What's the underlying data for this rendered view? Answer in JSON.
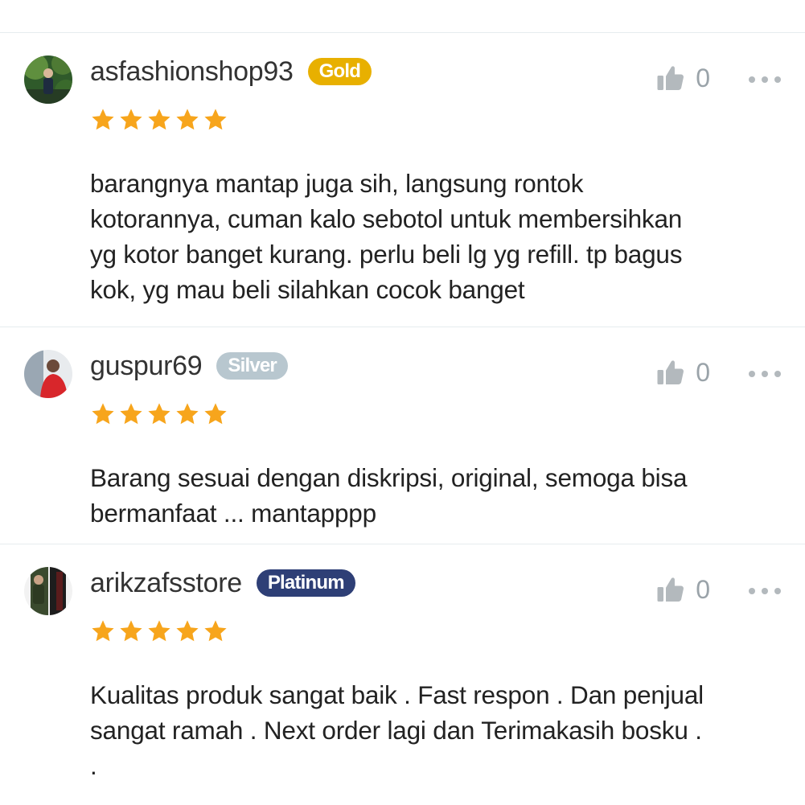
{
  "reviews": [
    {
      "username": "asfashionshop93",
      "badge": "Gold",
      "badge_color": "#e8b000",
      "rating": 5,
      "likes": "0",
      "text": "barangnya mantap juga sih, langsung rontok\nkotorannya, cuman kalo sebotol untuk membersihkan\nyg kotor banget kurang. perlu beli lg yg refill. tp bagus\nkok, yg mau beli silahkan cocok banget"
    },
    {
      "username": "guspur69",
      "badge": "Silver",
      "badge_color": "#b8c7cf",
      "rating": 5,
      "likes": "0",
      "text": "Barang sesuai dengan diskripsi, original, semoga bisa\nbermanfaat ... mantapppp"
    },
    {
      "username": "arikzafsstore",
      "badge": "Platinum",
      "badge_color": "#2e3f76",
      "rating": 5,
      "likes": "0",
      "text": "Kualitas produk sangat baik . Fast respon . Dan penjual\nsangat ramah . Next order lagi dan Terimakasih bosku .\n."
    }
  ],
  "colors": {
    "star": "#f7a51c",
    "icon_grey": "#b3b9bd",
    "divider": "#e6ecef"
  },
  "icons": [
    "thumbs-up-icon",
    "more-options-icon",
    "star-icon"
  ]
}
